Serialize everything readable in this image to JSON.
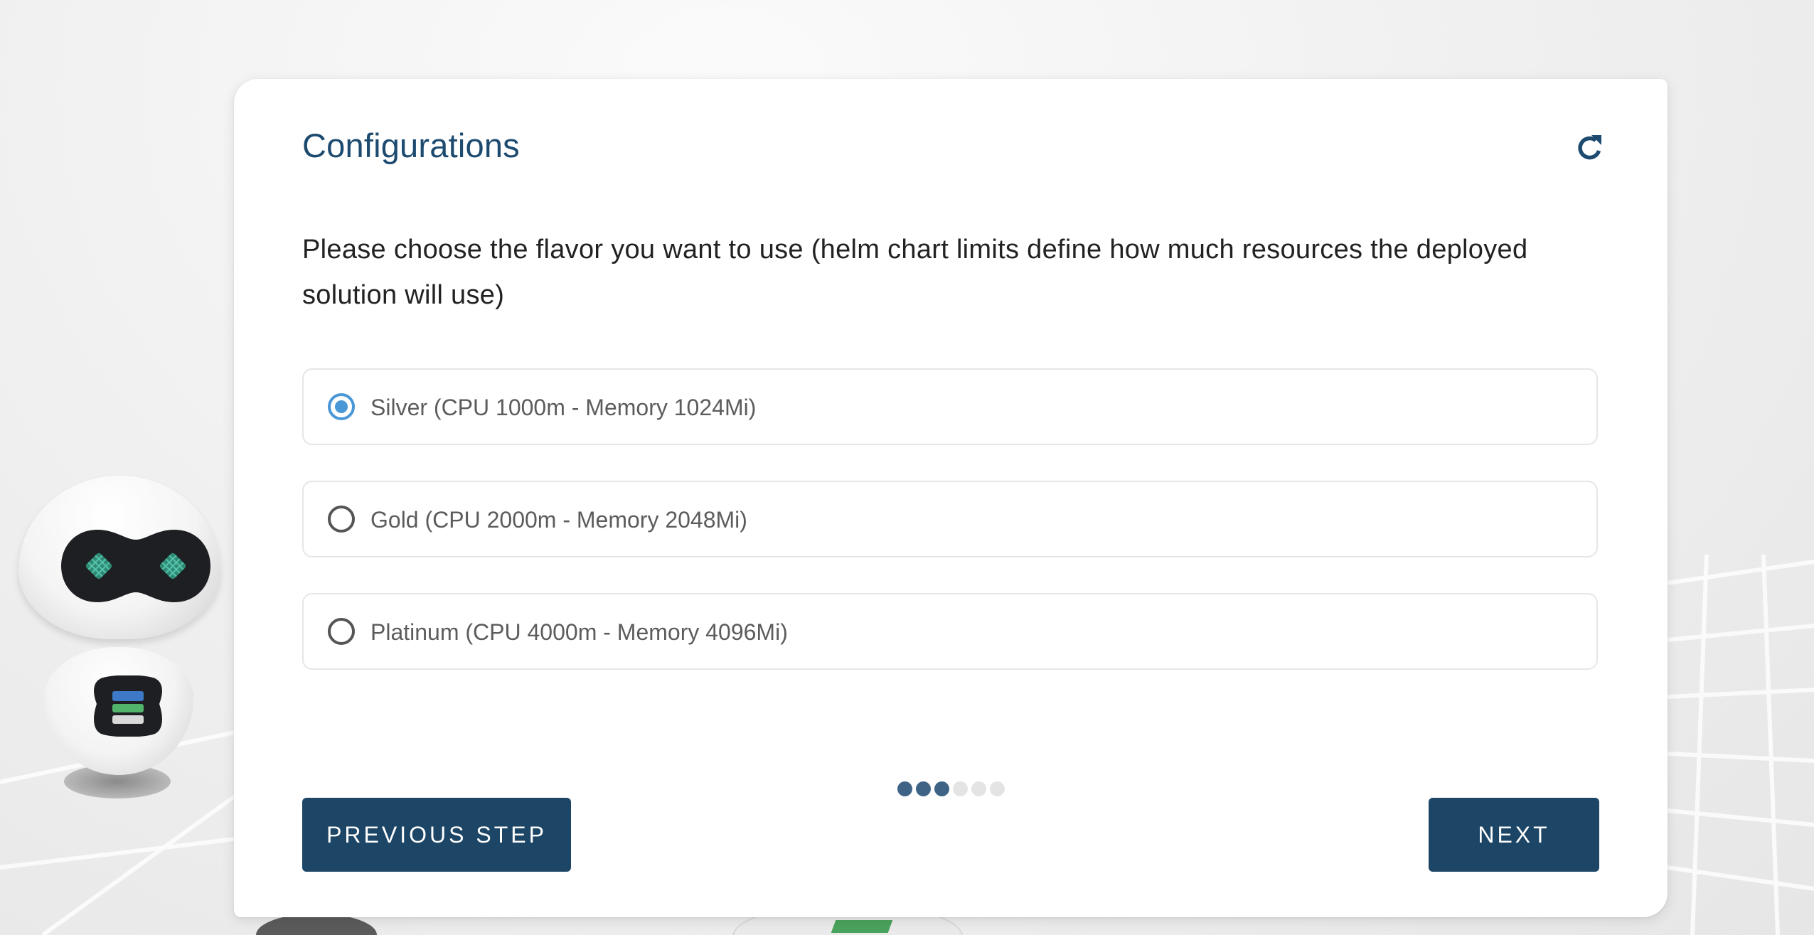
{
  "card": {
    "title": "Configurations",
    "instruction": "Please choose the flavor you want to use (helm chart limits define how much resources the deployed solution will use)"
  },
  "options": [
    {
      "label": "Silver (CPU 1000m - Memory 1024Mi)",
      "selected": true
    },
    {
      "label": "Gold (CPU 2000m - Memory 2048Mi)",
      "selected": false
    },
    {
      "label": "Platinum (CPU 4000m - Memory 4096Mi)",
      "selected": false
    }
  ],
  "stepper": {
    "total_steps": 6,
    "completed_steps": 3
  },
  "buttons": {
    "previous_label": "PREVIOUS STEP",
    "next_label": "NEXT"
  },
  "icons": {
    "refresh": "refresh-icon"
  },
  "colors": {
    "primary": "#1c4566",
    "title": "#1d4a6f",
    "radio_selected": "#4a97d6",
    "step_done": "#3e6385",
    "step_pending": "#e4e4e4"
  }
}
